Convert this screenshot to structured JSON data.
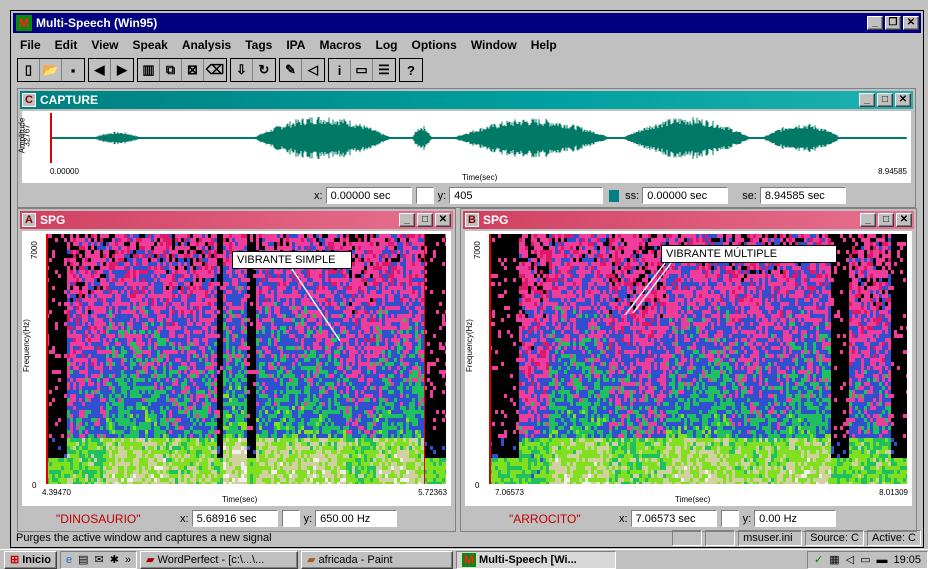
{
  "app": {
    "title": "Multi-Speech (Win95)"
  },
  "menu": [
    "File",
    "Edit",
    "View",
    "Speak",
    "Analysis",
    "Tags",
    "IPA",
    "Macros",
    "Log",
    "Options",
    "Window",
    "Help"
  ],
  "toolbar": {
    "groups": [
      [
        {
          "name": "new-icon",
          "glyph": "▯"
        },
        {
          "name": "open-icon",
          "glyph": "📂"
        },
        {
          "name": "save-icon",
          "glyph": "▪"
        }
      ],
      [
        {
          "name": "back-icon",
          "glyph": "◀"
        },
        {
          "name": "forward-icon",
          "glyph": "▶"
        }
      ],
      [
        {
          "name": "spectrogram-icon",
          "glyph": "▥"
        },
        {
          "name": "copy-window-icon",
          "glyph": "⧉"
        },
        {
          "name": "close-window-icon",
          "glyph": "⊠"
        },
        {
          "name": "eraser-icon",
          "glyph": "⌫"
        }
      ],
      [
        {
          "name": "record-icon",
          "glyph": "⇩"
        },
        {
          "name": "loop-icon",
          "glyph": "↻"
        }
      ],
      [
        {
          "name": "tools-icon",
          "glyph": "✎"
        },
        {
          "name": "speaker-icon",
          "glyph": "◁"
        }
      ],
      [
        {
          "name": "info-icon",
          "glyph": "i"
        },
        {
          "name": "window-icon",
          "glyph": "▭"
        },
        {
          "name": "list-icon",
          "glyph": "☰"
        }
      ],
      [
        {
          "name": "help-icon",
          "glyph": "?"
        }
      ]
    ]
  },
  "capture": {
    "letter": "C",
    "title": "CAPTURE",
    "ylabel_top": "Amplitude",
    "ylabel_val": "32767",
    "t_start": "0.00000",
    "t_end": "8.94585",
    "xlabel": "Time(sec)",
    "x_label": "x:",
    "x_value": "0.00000 sec",
    "y_label": "y:",
    "y_value": "405",
    "ss_label": "ss:",
    "ss_value": "0.00000 sec",
    "se_label": "se:",
    "se_value": "8.94585 sec"
  },
  "spgA": {
    "letter": "A",
    "title": "SPG",
    "y_max": "7000",
    "y_min": "0",
    "ylabel": "Frequency(Hz)",
    "t_start": "4.39470",
    "t_end": "5.72363",
    "xlabel": "Time(sec)",
    "annotation": "VIBRANTE SIMPLE",
    "word": "\"DINOSAURIO\"",
    "x_label": "x:",
    "x_value": "5.68916 sec",
    "y_label": "y:",
    "y_value": "650.00 Hz"
  },
  "spgB": {
    "letter": "B",
    "title": "SPG",
    "y_max": "7000",
    "y_min": "0",
    "ylabel": "Frequency(Hz)",
    "t_start": "7.06573",
    "t_end": "8.01309",
    "xlabel": "Time(sec)",
    "annotation": "VIBRANTE MÚLTIPLE",
    "word": "\"ARROCITO\"",
    "x_label": "x:",
    "x_value": "7.06573 sec",
    "y_label": "y:",
    "y_value": "0.00 Hz"
  },
  "status": {
    "message": "Purges the active window and captures a new signal",
    "ini": "msuser.ini",
    "source": "Source: C",
    "active": "Active: C"
  },
  "taskbar": {
    "start": "Inicio",
    "items": [
      "WordPerfect - [c:\\...\\...",
      "africada - Paint",
      "Multi-Speech [Wi..."
    ],
    "clock": "19:05"
  },
  "colors": {
    "title_active": "#000080",
    "capture_title": "#008080",
    "spg_title": "#d04060",
    "waveform": "#007a66"
  }
}
